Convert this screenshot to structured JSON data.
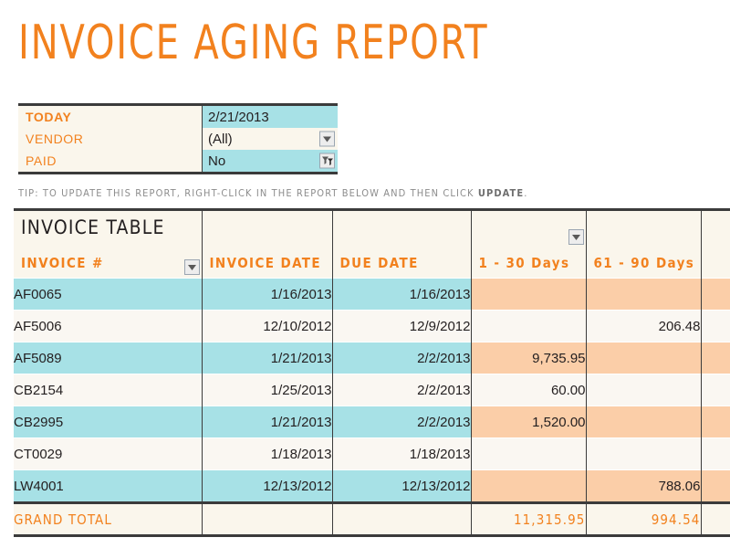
{
  "report": {
    "title": "INVOICE AGING REPORT"
  },
  "filters": {
    "rows": [
      {
        "label": "TODAY",
        "value": "2/21/2013",
        "control": "none",
        "bold": true,
        "value_bg": "cyan"
      },
      {
        "label": "VENDOR",
        "value": "(All)",
        "control": "dropdown",
        "bold": false,
        "value_bg": "cream"
      },
      {
        "label": "PAID",
        "value": "No",
        "control": "filter",
        "bold": false,
        "value_bg": "cyan"
      }
    ]
  },
  "tip": {
    "text_before": "TIP: TO UPDATE THIS REPORT, RIGHT-CLICK IN THE REPORT BELOW AND THEN CLICK ",
    "emphasis": "UPDATE",
    "text_after": "."
  },
  "table": {
    "title": "INVOICE TABLE",
    "columns": [
      {
        "label": "INVOICE #",
        "align": "left",
        "control": "dropdown"
      },
      {
        "label": "INVOICE DATE",
        "align": "left",
        "control": "none"
      },
      {
        "label": "DUE DATE",
        "align": "left",
        "control": "none"
      },
      {
        "label": "1 - 30 Days",
        "align": "left",
        "control": "dropdown"
      },
      {
        "label": "61 - 90 Days",
        "align": "left",
        "control": "none"
      },
      {
        "label": "",
        "align": "left",
        "control": "none"
      }
    ],
    "rows": [
      {
        "invoice": "AF0065",
        "invoice_date": "1/16/2013",
        "due_date": "1/16/2013",
        "d1_30": "",
        "d61_90": "",
        "extra": ""
      },
      {
        "invoice": "AF5006",
        "invoice_date": "12/10/2012",
        "due_date": "12/9/2012",
        "d1_30": "",
        "d61_90": "206.48",
        "extra": ""
      },
      {
        "invoice": "AF5089",
        "invoice_date": "1/21/2013",
        "due_date": "2/2/2013",
        "d1_30": "9,735.95",
        "d61_90": "",
        "extra": ""
      },
      {
        "invoice": "CB2154",
        "invoice_date": "1/25/2013",
        "due_date": "2/2/2013",
        "d1_30": "60.00",
        "d61_90": "",
        "extra": ""
      },
      {
        "invoice": "CB2995",
        "invoice_date": "1/21/2013",
        "due_date": "2/2/2013",
        "d1_30": "1,520.00",
        "d61_90": "",
        "extra": ""
      },
      {
        "invoice": "CT0029",
        "invoice_date": "1/18/2013",
        "due_date": "1/18/2013",
        "d1_30": "",
        "d61_90": "",
        "extra": ""
      },
      {
        "invoice": "LW4001",
        "invoice_date": "12/13/2012",
        "due_date": "12/13/2012",
        "d1_30": "",
        "d61_90": "788.06",
        "extra": ""
      }
    ],
    "total": {
      "label": "GRAND TOTAL",
      "invoice_date": "",
      "due_date": "",
      "d1_30": "11,315.95",
      "d61_90": "994.54",
      "extra": ""
    }
  },
  "colors": {
    "orange": "#F2811E",
    "cyan": "#A7E1E6",
    "peach": "#FBCEA8",
    "cream": "#FAF6EC",
    "ink": "#231F20",
    "rule": "#3B3B3B"
  }
}
